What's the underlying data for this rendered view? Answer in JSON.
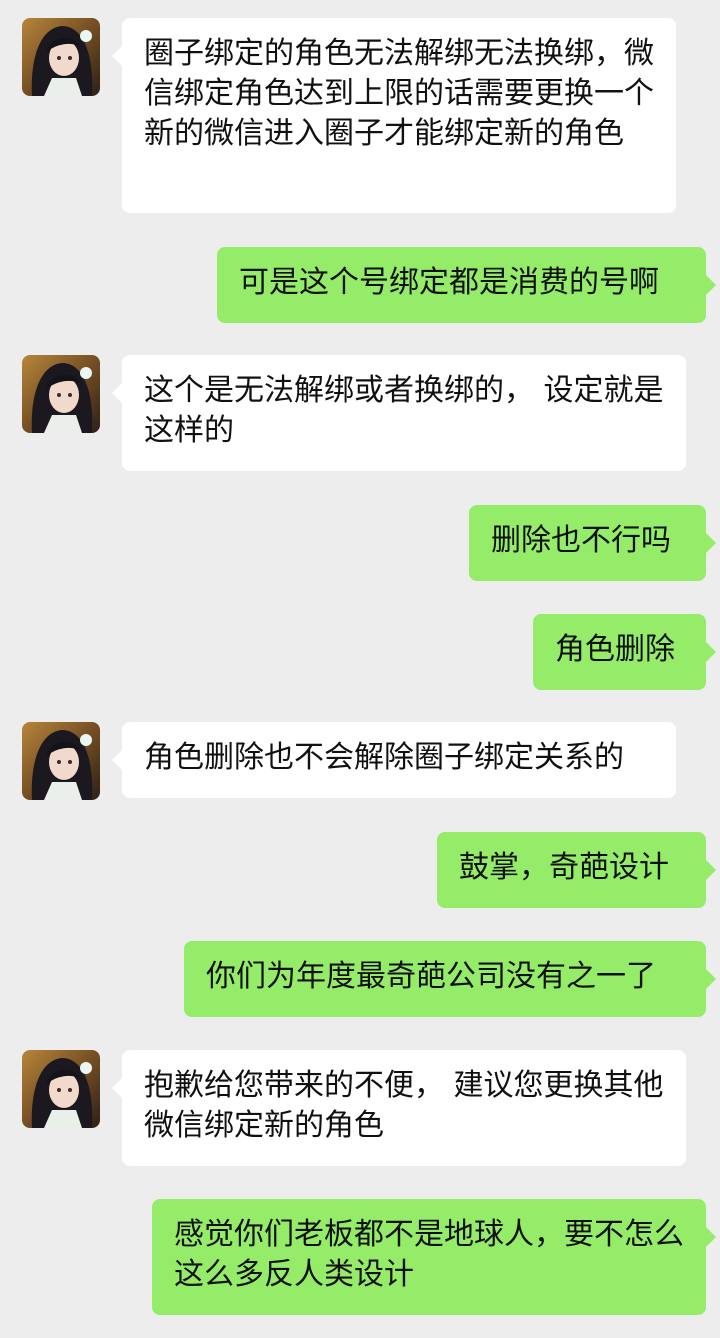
{
  "colors": {
    "background": "#ededed",
    "incoming_bubble": "#ffffff",
    "outgoing_bubble": "#95ec69"
  },
  "messages": [
    {
      "side": "left",
      "text": "圈子绑定的角色无法解绑无法换绑，微信绑定角色达到上限的话需要更换一个新的微信进入圈子才能绑定新的角色"
    },
    {
      "side": "right",
      "text": "可是这个号绑定都是消费的号啊"
    },
    {
      "side": "left",
      "text": "这个是无法解绑或者换绑的， 设定就是这样的"
    },
    {
      "side": "right",
      "text": "删除也不行吗"
    },
    {
      "side": "right",
      "text": "角色删除"
    },
    {
      "side": "left",
      "text": "角色删除也不会解除圈子绑定关系的"
    },
    {
      "side": "right",
      "text": "鼓掌，奇葩设计"
    },
    {
      "side": "right",
      "text": "你们为年度最奇葩公司没有之一了"
    },
    {
      "side": "left",
      "text": "抱歉给您带来的不便， 建议您更换其他微信绑定新的角色"
    },
    {
      "side": "right",
      "text": "感觉你们老板都不是地球人，要不怎么这么多反人类设计"
    }
  ]
}
